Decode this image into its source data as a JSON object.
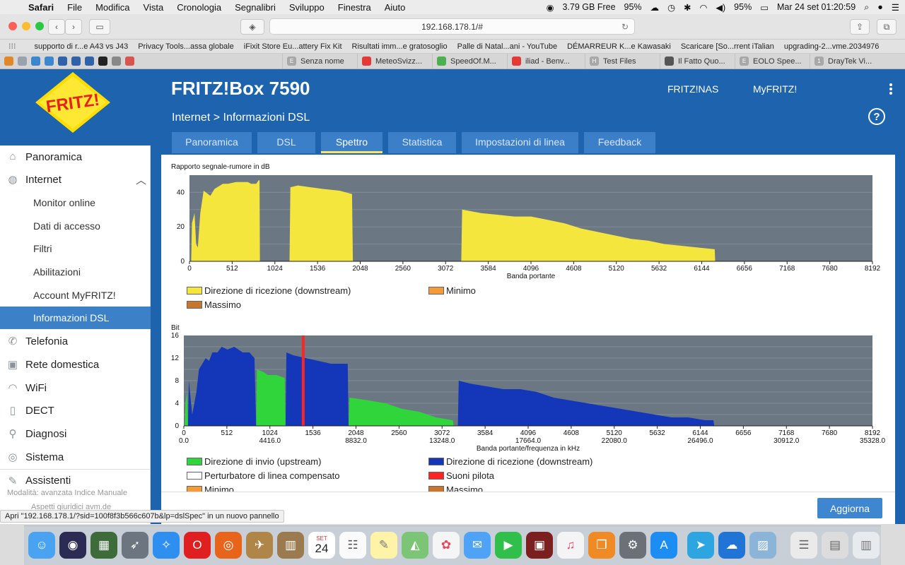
{
  "menubar": {
    "items": [
      "Safari",
      "File",
      "Modifica",
      "Vista",
      "Cronologia",
      "Segnalibri",
      "Sviluppo",
      "Finestra",
      "Aiuto"
    ],
    "status_memory": "3.79 GB Free",
    "status_cpu": "95%",
    "status_battery": "95%",
    "status_clock": "Mar 24 set  01:20:59"
  },
  "browser": {
    "url": "192.168.178.1/#",
    "bookmarks": [
      "supporto di r...e A43 vs J43",
      "Privacy Tools...assa globale",
      "iFixit Store Eu...attery Fix Kit",
      "Risultati imm...e gratosoglio",
      "Palle di Natal...ani - YouTube",
      "DÉMARREUR K...e Kawasaki",
      "Scaricare [So...rrent iTalian",
      "upgrading-2...vme.2034976"
    ],
    "tabs": [
      "Senza nome",
      "MeteoSvizz...",
      "SpeedOf.M...",
      "iliad - Benv...",
      "Test Files",
      "Il Fatto Quo...",
      "EOLO Spee...",
      "DrayTek Vi..."
    ],
    "tab_favicon_letters": [
      "E",
      "",
      "",
      "",
      "H",
      "",
      "E",
      "1"
    ],
    "status_text": "Apri \"192.168.178.1/?sid=100f8f3b566c607b&lp=dslSpec\" in un nuovo pannello"
  },
  "fritz": {
    "logo_text": "FRITZ!",
    "product": "FRITZ!Box 7590",
    "header_links": [
      "FRITZ!NAS",
      "MyFRITZ!"
    ],
    "breadcrumb": "Internet > Informazioni DSL",
    "help": "?",
    "page_tabs": [
      {
        "label": "Panoramica",
        "active": false
      },
      {
        "label": "DSL",
        "active": false
      },
      {
        "label": "Spettro",
        "active": true
      },
      {
        "label": "Statistica",
        "active": false
      },
      {
        "label": "Impostazioni di linea",
        "active": false
      },
      {
        "label": "Feedback",
        "active": false
      }
    ],
    "sidebar": {
      "main": [
        {
          "label": "Panoramica",
          "icon": "home-icon"
        },
        {
          "label": "Internet",
          "icon": "globe-icon"
        },
        {
          "label": "Telefonia",
          "icon": "phone-icon"
        },
        {
          "label": "Rete domestica",
          "icon": "network-icon"
        },
        {
          "label": "WiFi",
          "icon": "wifi-icon"
        },
        {
          "label": "DECT",
          "icon": "dect-icon"
        },
        {
          "label": "Diagnosi",
          "icon": "diagnosis-icon"
        },
        {
          "label": "Sistema",
          "icon": "system-icon"
        },
        {
          "label": "Assistenti",
          "icon": "wizard-icon"
        }
      ],
      "internet_sub": [
        "Monitor online",
        "Dati di accesso",
        "Filtri",
        "Abilitazioni",
        "Account MyFRITZ!",
        "Informazioni DSL"
      ],
      "active_sub": "Informazioni DSL",
      "footer_text": "Modalità: avanzata   Indice   Manuale",
      "footer_text2": "Aspetti giuridici   avm.de"
    },
    "apply_button": "Aggiorna"
  },
  "chart_data": [
    {
      "type": "area",
      "title": "Rapporto segnale-rumore in dB",
      "xlabel": "Banda portante",
      "ylabel": "",
      "xlim": [
        0,
        8192
      ],
      "ylim": [
        0,
        50
      ],
      "x_ticks": [
        0,
        512,
        1024,
        1536,
        2048,
        2560,
        3072,
        3584,
        4096,
        4608,
        5120,
        5632,
        6144,
        6656,
        7168,
        7680,
        8192
      ],
      "y_ticks": [
        0,
        20,
        40
      ],
      "grid": true,
      "legend": [
        "Direzione di ricezione (downstream)",
        "Minimo",
        "Massimo"
      ],
      "legend_colors": [
        "#f5e63d",
        "#f49a36",
        "#c7772d"
      ],
      "series": [
        {
          "name": "Direzione di ricezione (downstream)",
          "color": "#f5e63d",
          "points": [
            [
              0,
              0
            ],
            [
              20,
              0
            ],
            [
              30,
              22
            ],
            [
              60,
              28
            ],
            [
              80,
              10
            ],
            [
              100,
              8
            ],
            [
              130,
              28
            ],
            [
              170,
              41
            ],
            [
              250,
              38
            ],
            [
              300,
              42
            ],
            [
              400,
              45
            ],
            [
              460,
              45
            ],
            [
              560,
              46
            ],
            [
              700,
              46
            ],
            [
              740,
              45
            ],
            [
              800,
              45
            ],
            [
              830,
              47
            ],
            [
              840,
              47
            ],
            [
              845,
              0
            ]
          ]
        },
        {
          "name": "Direzione di ricezione (downstream)",
          "color": "#f5e63d",
          "points": [
            [
              1200,
              0
            ],
            [
              1210,
              43
            ],
            [
              1300,
              44
            ],
            [
              1450,
              43
            ],
            [
              1600,
              42
            ],
            [
              1800,
              41
            ],
            [
              1950,
              39
            ],
            [
              1960,
              0
            ]
          ]
        },
        {
          "name": "Direzione di ricezione (downstream)",
          "color": "#f5e63d",
          "points": [
            [
              3260,
              0
            ],
            [
              3270,
              30
            ],
            [
              3500,
              28
            ],
            [
              3700,
              27
            ],
            [
              3900,
              26
            ],
            [
              4100,
              26
            ],
            [
              4300,
              24
            ],
            [
              4500,
              22
            ],
            [
              4700,
              19
            ],
            [
              4900,
              17
            ],
            [
              5100,
              15
            ],
            [
              5300,
              13
            ],
            [
              5500,
              12
            ],
            [
              5700,
              10
            ],
            [
              5900,
              9
            ],
            [
              6100,
              8
            ],
            [
              6300,
              7
            ],
            [
              6305,
              0
            ]
          ]
        }
      ]
    },
    {
      "type": "area",
      "title": "Bit",
      "xlabel": "Banda portante/frequenza in kHz",
      "ylabel": "",
      "xlim": [
        0,
        8192
      ],
      "ylim": [
        0,
        16
      ],
      "x_ticks": [
        0,
        512,
        1024,
        1536,
        2048,
        2560,
        3072,
        3584,
        4096,
        4608,
        5120,
        5632,
        6144,
        6656,
        7168,
        7680,
        8192
      ],
      "x_freq_ticks": [
        [
          0,
          "0.0"
        ],
        [
          1024,
          "4416.0"
        ],
        [
          2048,
          "8832.0"
        ],
        [
          3072,
          "13248.0"
        ],
        [
          4096,
          "17664.0"
        ],
        [
          5120,
          "22080.0"
        ],
        [
          6144,
          "26496.0"
        ],
        [
          7168,
          "30912.0"
        ],
        [
          8192,
          "35328.0"
        ]
      ],
      "y_ticks": [
        0,
        4,
        8,
        12,
        16
      ],
      "grid": true,
      "legend": [
        "Direzione di invio (upstream)",
        "Direzione di ricezione (downstream)",
        "Perturbatore di linea compensato",
        "Suoni pilota",
        "Minimo",
        "Massimo"
      ],
      "legend_colors": [
        "#2fd53a",
        "#1436b8",
        "#ffffff",
        "#ff2424",
        "#f49a36",
        "#c7772d"
      ],
      "pilot_tone": 1420,
      "series": [
        {
          "name": "Direzione di invio (upstream)",
          "color": "#2fd53a",
          "points": [
            [
              0,
              0
            ],
            [
              10,
              0
            ],
            [
              20,
              4
            ],
            [
              40,
              6
            ],
            [
              50,
              0
            ]
          ]
        },
        {
          "name": "Direzione di ricezione (downstream)",
          "color": "#1436b8",
          "points": [
            [
              50,
              0
            ],
            [
              60,
              8
            ],
            [
              80,
              5
            ],
            [
              100,
              2
            ],
            [
              150,
              6
            ],
            [
              180,
              10
            ],
            [
              220,
              11
            ],
            [
              260,
              12
            ],
            [
              300,
              11.5
            ],
            [
              340,
              13
            ],
            [
              400,
              13
            ],
            [
              450,
              14
            ],
            [
              520,
              13.5
            ],
            [
              600,
              14
            ],
            [
              700,
              13
            ],
            [
              780,
              13
            ],
            [
              840,
              12
            ],
            [
              860,
              0
            ]
          ]
        },
        {
          "name": "Direzione di invio (upstream)",
          "color": "#2fd53a",
          "points": [
            [
              860,
              0
            ],
            [
              870,
              10
            ],
            [
              950,
              9.5
            ],
            [
              1000,
              9
            ],
            [
              1100,
              9
            ],
            [
              1200,
              8.5
            ],
            [
              1210,
              0
            ]
          ]
        },
        {
          "name": "Direzione di ricezione (downstream)",
          "color": "#1436b8",
          "points": [
            [
              1210,
              0
            ],
            [
              1220,
              13
            ],
            [
              1300,
              12.5
            ],
            [
              1450,
              12
            ],
            [
              1600,
              11.5
            ],
            [
              1750,
              11
            ],
            [
              1950,
              11
            ],
            [
              1960,
              0
            ]
          ]
        },
        {
          "name": "Direzione di invio (upstream)",
          "color": "#2fd53a",
          "points": [
            [
              1960,
              0
            ],
            [
              1970,
              5
            ],
            [
              2200,
              4.5
            ],
            [
              2400,
              4
            ],
            [
              2600,
              3
            ],
            [
              2800,
              2.5
            ],
            [
              3000,
              1.5
            ],
            [
              3200,
              1
            ],
            [
              3210,
              0
            ]
          ]
        },
        {
          "name": "Direzione di ricezione (downstream)",
          "color": "#1436b8",
          "points": [
            [
              3260,
              0
            ],
            [
              3270,
              8
            ],
            [
              3400,
              7.5
            ],
            [
              3600,
              7
            ],
            [
              3800,
              6.5
            ],
            [
              4000,
              6.5
            ],
            [
              4200,
              6
            ],
            [
              4400,
              5
            ],
            [
              4600,
              4.5
            ],
            [
              4800,
              4
            ],
            [
              5000,
              3.5
            ],
            [
              5200,
              3
            ],
            [
              5400,
              2.5
            ],
            [
              5600,
              2
            ],
            [
              5800,
              1.5
            ],
            [
              6000,
              1.5
            ],
            [
              6200,
              1
            ],
            [
              6300,
              1
            ],
            [
              6310,
              0
            ]
          ]
        }
      ]
    }
  ],
  "dock": {
    "calendar_month": "SET",
    "calendar_day": "24"
  }
}
